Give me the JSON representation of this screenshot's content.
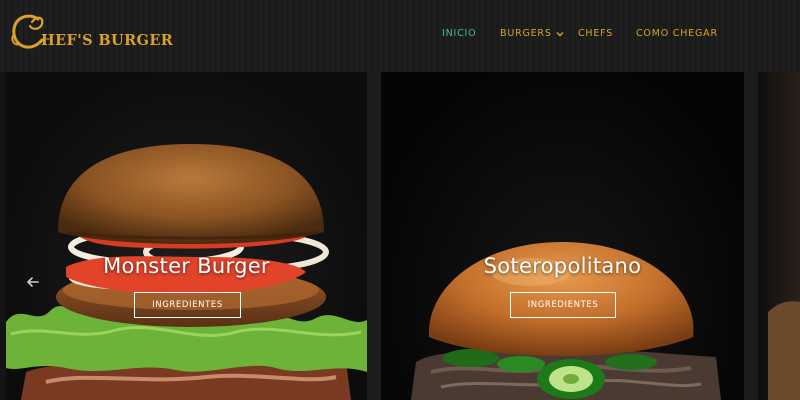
{
  "brand": {
    "name": "CHEF'S BURGER",
    "logo_text_rest": "HEF'S BURGER",
    "logo_initial": "C",
    "color": "#d9a12a"
  },
  "nav": {
    "items": [
      {
        "label": "INICIO",
        "active": true
      },
      {
        "label": "BURGERS",
        "has_dropdown": true
      },
      {
        "label": "CHEFS"
      },
      {
        "label": "COMO CHEGAR"
      }
    ],
    "active_color": "#43b8a4",
    "item_color": "#d9a12a"
  },
  "slider": {
    "prev_icon": "arrow-left-icon",
    "slides": [
      {
        "title": "Monster Burger",
        "button": "INGREDIENTES"
      },
      {
        "title": "Soteropolitano",
        "button": "INGREDIENTES"
      }
    ]
  }
}
